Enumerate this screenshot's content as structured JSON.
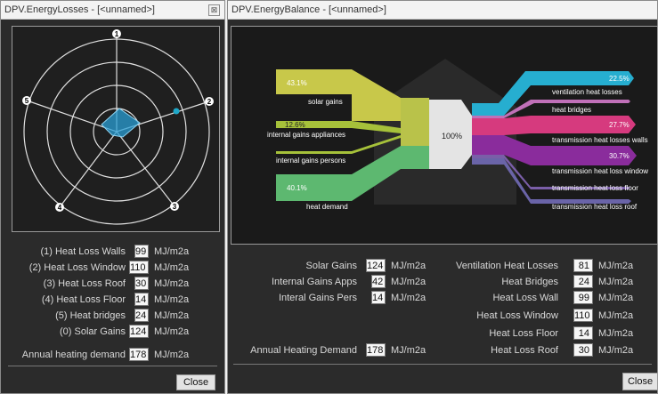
{
  "losses_window": {
    "title": "DPV.EnergyLosses - [<unnamed>]",
    "close_glyph": "⊠",
    "radar": {
      "axis_labels": [
        "1",
        "2",
        "3",
        "4",
        "5"
      ],
      "series_color": "#2a9fd6",
      "marker_color": "#1fa8c9"
    },
    "fields": [
      {
        "label": "(1) Heat Loss Walls",
        "value": "99",
        "unit": "MJ/m2a"
      },
      {
        "label": "(2) Heat Loss Window",
        "value": "110",
        "unit": "MJ/m2a"
      },
      {
        "label": "(3) Heat Loss Roof",
        "value": "30",
        "unit": "MJ/m2a"
      },
      {
        "label": "(4) Heat Loss Floor",
        "value": "14",
        "unit": "MJ/m2a"
      },
      {
        "label": "(5) Heat bridges",
        "value": "24",
        "unit": "MJ/m2a"
      },
      {
        "label": "(0) Solar Gains",
        "value": "124",
        "unit": "MJ/m2a"
      }
    ],
    "annual": {
      "label": "Annual heating demand",
      "value": "178",
      "unit": "MJ/m2a"
    },
    "close_label": "Close"
  },
  "balance_window": {
    "title": "DPV.EnergyBalance - [<unnamed>]",
    "sankey": {
      "center_label": "100%",
      "inputs": [
        {
          "pct": "43.1%",
          "label": "solar gains",
          "color": "#c8c84a"
        },
        {
          "pct": "12.6%",
          "label": "internal gains appliances",
          "color": "#a6c13a"
        },
        {
          "pct": "",
          "label": "internal gains persons",
          "color": "#a6c13a"
        },
        {
          "pct": "40.1%",
          "label": "heat demand",
          "color": "#5db870"
        }
      ],
      "outputs": [
        {
          "pct": "22.5%",
          "label": "ventilation heat losses",
          "color": "#26aed0"
        },
        {
          "pct": "",
          "label": "heat bridges",
          "color": "#c070b8"
        },
        {
          "pct": "27.7%",
          "label": "transmission heat losses walls",
          "color": "#d63a7e"
        },
        {
          "pct": "30.7%",
          "label": "transmission heat loss window",
          "color": "#8a2c9c"
        },
        {
          "pct": "",
          "label": "transmission heat loss floor",
          "color": "#7a5ea8"
        },
        {
          "pct": "",
          "label": "transmission heat loss roof",
          "color": "#6a64a8"
        }
      ]
    },
    "left_fields": [
      {
        "label": "Solar Gains",
        "value": "124",
        "unit": "MJ/m2a"
      },
      {
        "label": "Internal Gains Apps",
        "value": "42",
        "unit": "MJ/m2a"
      },
      {
        "label": "Interal Gains Pers",
        "value": "14",
        "unit": "MJ/m2a"
      }
    ],
    "annual": {
      "label": "Annual Heating Demand",
      "value": "178",
      "unit": "MJ/m2a"
    },
    "right_fields": [
      {
        "label": "Ventilation Heat Losses",
        "value": "81",
        "unit": "MJ/m2a"
      },
      {
        "label": "Heat Bridges",
        "value": "24",
        "unit": "MJ/m2a"
      },
      {
        "label": "Heat Loss Wall",
        "value": "99",
        "unit": "MJ/m2a"
      },
      {
        "label": "Heat Loss Window",
        "value": "110",
        "unit": "MJ/m2a"
      },
      {
        "label": "Heat Loss Floor",
        "value": "14",
        "unit": "MJ/m2a"
      },
      {
        "label": "Heat Loss Roof",
        "value": "30",
        "unit": "MJ/m2a"
      }
    ],
    "close_label": "Close"
  }
}
